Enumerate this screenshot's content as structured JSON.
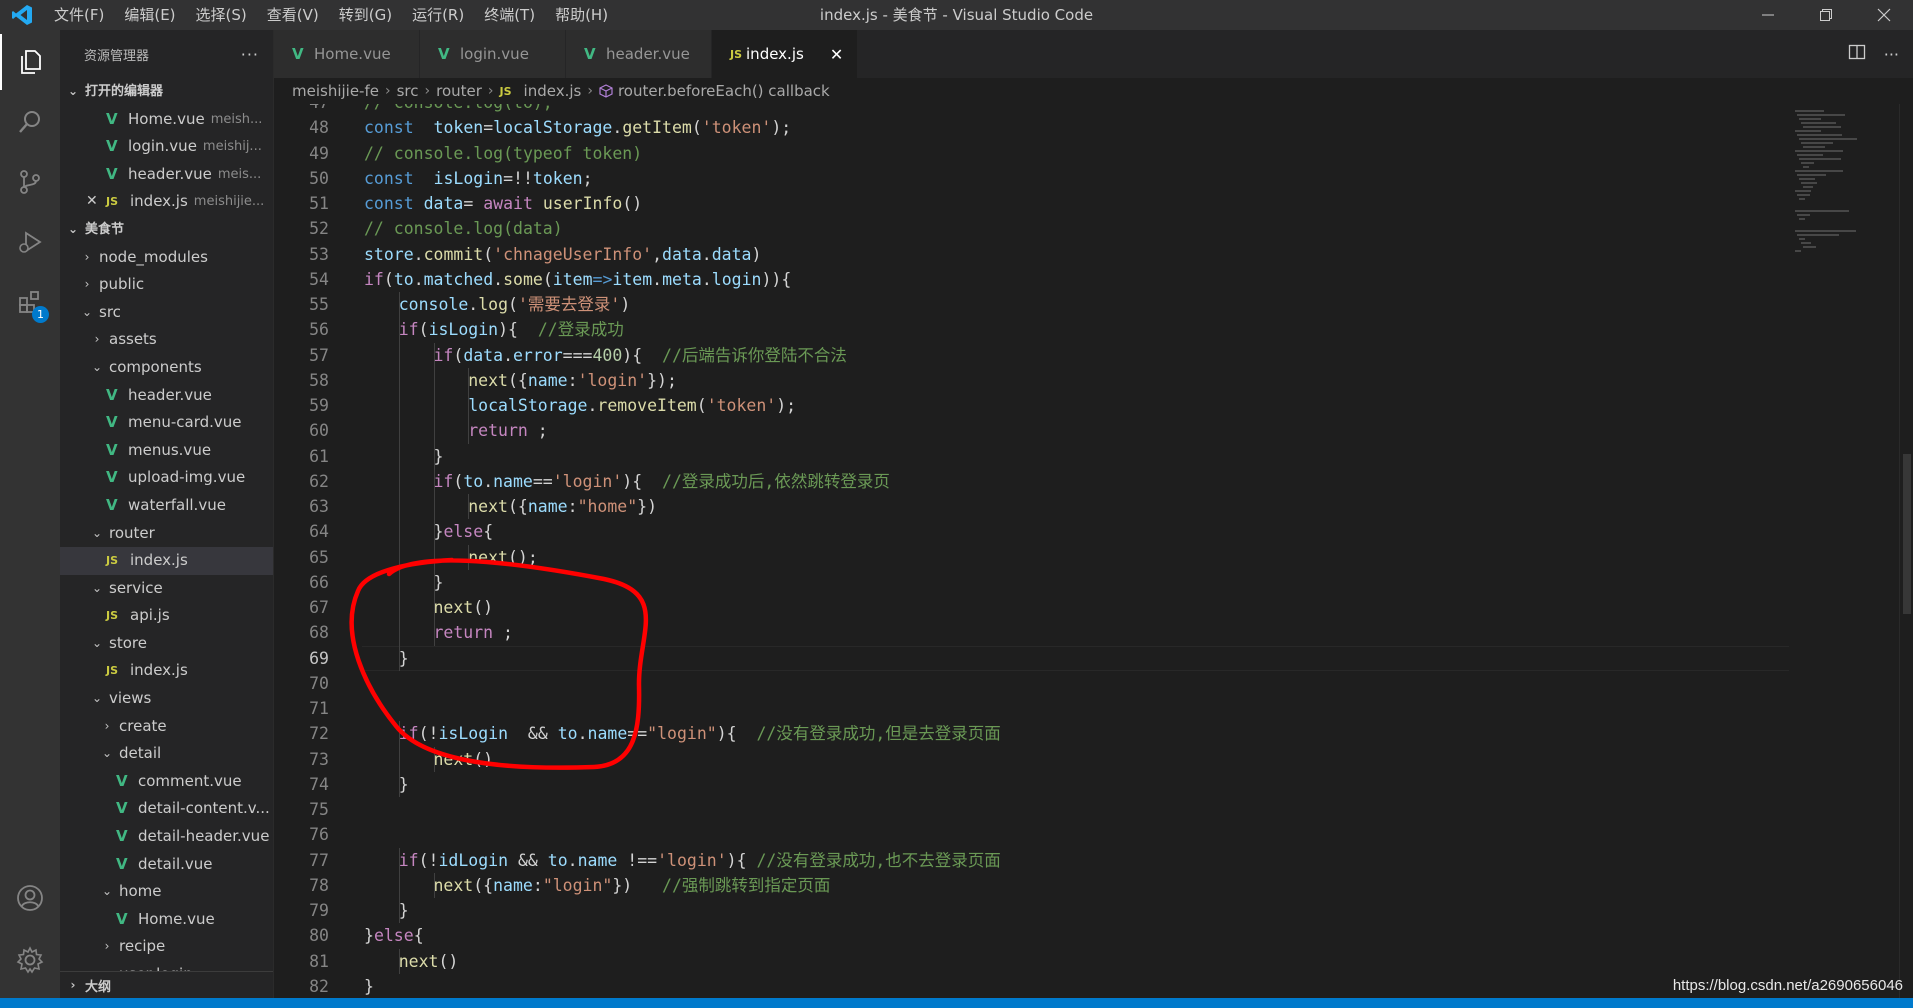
{
  "window": {
    "title": "index.js - 美食节 - Visual Studio Code",
    "menu": [
      "文件(F)",
      "编辑(E)",
      "选择(S)",
      "查看(V)",
      "转到(G)",
      "运行(R)",
      "终端(T)",
      "帮助(H)"
    ],
    "controls": [
      "minimize",
      "restore",
      "close"
    ]
  },
  "activity_bar": {
    "items": [
      "explorer-icon",
      "search-icon",
      "source-control-icon",
      "run-debug-icon",
      "extensions-icon"
    ],
    "extensions_badge": "1",
    "bottom": [
      "accounts-icon",
      "manage-gear-icon"
    ]
  },
  "sidebar": {
    "title": "资源管理器",
    "more": "···",
    "open_editors_label": "打开的编辑器",
    "open_editors": [
      {
        "name": "Home.vue",
        "desc": "meish...",
        "icon": "vue"
      },
      {
        "name": "login.vue",
        "desc": "meishij...",
        "icon": "vue"
      },
      {
        "name": "header.vue",
        "desc": "meis...",
        "icon": "vue"
      },
      {
        "name": "index.js",
        "desc": "meishijie...",
        "icon": "js",
        "close": "✕"
      }
    ],
    "workspace_label": "美食节",
    "tree": [
      {
        "name": "node_modules",
        "depth": 1,
        "type": "folder-closed"
      },
      {
        "name": "public",
        "depth": 1,
        "type": "folder-closed"
      },
      {
        "name": "src",
        "depth": 1,
        "type": "folder-open"
      },
      {
        "name": "assets",
        "depth": 2,
        "type": "folder-closed"
      },
      {
        "name": "components",
        "depth": 2,
        "type": "folder-open"
      },
      {
        "name": "header.vue",
        "depth": 3,
        "type": "vue"
      },
      {
        "name": "menu-card.vue",
        "depth": 3,
        "type": "vue"
      },
      {
        "name": "menus.vue",
        "depth": 3,
        "type": "vue"
      },
      {
        "name": "upload-img.vue",
        "depth": 3,
        "type": "vue"
      },
      {
        "name": "waterfall.vue",
        "depth": 3,
        "type": "vue"
      },
      {
        "name": "router",
        "depth": 2,
        "type": "folder-open"
      },
      {
        "name": "index.js",
        "depth": 3,
        "type": "js",
        "selected": true
      },
      {
        "name": "service",
        "depth": 2,
        "type": "folder-open"
      },
      {
        "name": "api.js",
        "depth": 3,
        "type": "js"
      },
      {
        "name": "store",
        "depth": 2,
        "type": "folder-open"
      },
      {
        "name": "index.js",
        "depth": 3,
        "type": "js"
      },
      {
        "name": "views",
        "depth": 2,
        "type": "folder-open"
      },
      {
        "name": "create",
        "depth": 3,
        "type": "folder-closed"
      },
      {
        "name": "detail",
        "depth": 3,
        "type": "folder-open"
      },
      {
        "name": "comment.vue",
        "depth": 4,
        "type": "vue"
      },
      {
        "name": "detail-content.v...",
        "depth": 4,
        "type": "vue"
      },
      {
        "name": "detail-header.vue",
        "depth": 4,
        "type": "vue"
      },
      {
        "name": "detail.vue",
        "depth": 4,
        "type": "vue"
      },
      {
        "name": "home",
        "depth": 3,
        "type": "folder-open"
      },
      {
        "name": "Home.vue",
        "depth": 4,
        "type": "vue"
      },
      {
        "name": "recipe",
        "depth": 3,
        "type": "folder-closed"
      },
      {
        "name": "user-login",
        "depth": 3,
        "type": "folder-open"
      }
    ],
    "outline_label": "大纲"
  },
  "tabs": [
    {
      "label": "Home.vue",
      "icon": "vue",
      "active": false
    },
    {
      "label": "login.vue",
      "icon": "vue",
      "active": false
    },
    {
      "label": "header.vue",
      "icon": "vue",
      "active": false
    },
    {
      "label": "index.js",
      "icon": "js",
      "active": true,
      "close": "✕"
    }
  ],
  "breadcrumb": [
    "meishijie-fe",
    "src",
    "router",
    "index.js",
    "router.beforeEach() callback"
  ],
  "editor": {
    "current_line": 69,
    "lines": [
      {
        "n": 47,
        "indent": 1,
        "tokens": [
          [
            "c",
            "// console.log(to);"
          ]
        ]
      },
      {
        "n": 48,
        "indent": 1,
        "tokens": [
          [
            "k",
            "const"
          ],
          [
            "p",
            "  "
          ],
          [
            "v",
            "token"
          ],
          [
            "p",
            "="
          ],
          [
            "v",
            "localStorage"
          ],
          [
            "p",
            "."
          ],
          [
            "f",
            "getItem"
          ],
          [
            "p",
            "("
          ],
          [
            "s",
            "'token'"
          ],
          [
            "p",
            ");"
          ]
        ]
      },
      {
        "n": 49,
        "indent": 1,
        "tokens": [
          [
            "c",
            "// console.log(typeof token)"
          ]
        ]
      },
      {
        "n": 50,
        "indent": 1,
        "tokens": [
          [
            "k",
            "const"
          ],
          [
            "p",
            "  "
          ],
          [
            "v",
            "isLogin"
          ],
          [
            "p",
            "=!!"
          ],
          [
            "v",
            "token"
          ],
          [
            "p",
            ";"
          ]
        ]
      },
      {
        "n": 51,
        "indent": 1,
        "tokens": [
          [
            "k",
            "const"
          ],
          [
            "p",
            " "
          ],
          [
            "v",
            "data"
          ],
          [
            "p",
            "= "
          ],
          [
            "kw",
            "await"
          ],
          [
            "p",
            " "
          ],
          [
            "f",
            "userInfo"
          ],
          [
            "p",
            "()"
          ]
        ]
      },
      {
        "n": 52,
        "indent": 1,
        "tokens": [
          [
            "c",
            "// console.log(data)"
          ]
        ]
      },
      {
        "n": 53,
        "indent": 1,
        "tokens": [
          [
            "v",
            "store"
          ],
          [
            "p",
            "."
          ],
          [
            "f",
            "commit"
          ],
          [
            "p",
            "("
          ],
          [
            "s",
            "'chnageUserInfo'"
          ],
          [
            "p",
            ","
          ],
          [
            "v",
            "data"
          ],
          [
            "p",
            "."
          ],
          [
            "v",
            "data"
          ],
          [
            "p",
            ")"
          ]
        ]
      },
      {
        "n": 54,
        "indent": 1,
        "tokens": [
          [
            "kw",
            "if"
          ],
          [
            "p",
            "("
          ],
          [
            "v",
            "to"
          ],
          [
            "p",
            "."
          ],
          [
            "v",
            "matched"
          ],
          [
            "p",
            "."
          ],
          [
            "f",
            "some"
          ],
          [
            "p",
            "("
          ],
          [
            "v",
            "item"
          ],
          [
            "k",
            "=>"
          ],
          [
            "v",
            "item"
          ],
          [
            "p",
            "."
          ],
          [
            "v",
            "meta"
          ],
          [
            "p",
            "."
          ],
          [
            "v",
            "login"
          ],
          [
            "p",
            ")){"
          ]
        ]
      },
      {
        "n": 55,
        "indent": 2,
        "tokens": [
          [
            "v",
            "console"
          ],
          [
            "p",
            "."
          ],
          [
            "f",
            "log"
          ],
          [
            "p",
            "("
          ],
          [
            "s",
            "'需要去登录'"
          ],
          [
            "p",
            ")"
          ]
        ]
      },
      {
        "n": 56,
        "indent": 2,
        "tokens": [
          [
            "kw",
            "if"
          ],
          [
            "p",
            "("
          ],
          [
            "v",
            "isLogin"
          ],
          [
            "p",
            "){  "
          ],
          [
            "c",
            "//登录成功"
          ]
        ]
      },
      {
        "n": 57,
        "indent": 3,
        "tokens": [
          [
            "kw",
            "if"
          ],
          [
            "p",
            "("
          ],
          [
            "v",
            "data"
          ],
          [
            "p",
            "."
          ],
          [
            "v",
            "error"
          ],
          [
            "p",
            "==="
          ],
          [
            "n",
            "400"
          ],
          [
            "p",
            "){  "
          ],
          [
            "c",
            "//后端告诉你登陆不合法"
          ]
        ]
      },
      {
        "n": 58,
        "indent": 4,
        "tokens": [
          [
            "f",
            "next"
          ],
          [
            "p",
            "({"
          ],
          [
            "v",
            "name"
          ],
          [
            "p",
            ":"
          ],
          [
            "s",
            "'login'"
          ],
          [
            "p",
            "});"
          ]
        ]
      },
      {
        "n": 59,
        "indent": 4,
        "tokens": [
          [
            "v",
            "localStorage"
          ],
          [
            "p",
            "."
          ],
          [
            "f",
            "removeItem"
          ],
          [
            "p",
            "("
          ],
          [
            "s",
            "'token'"
          ],
          [
            "p",
            ");"
          ]
        ]
      },
      {
        "n": 60,
        "indent": 4,
        "tokens": [
          [
            "kw",
            "return"
          ],
          [
            "p",
            " ;"
          ]
        ]
      },
      {
        "n": 61,
        "indent": 3,
        "tokens": [
          [
            "p",
            "}"
          ]
        ]
      },
      {
        "n": 62,
        "indent": 3,
        "tokens": [
          [
            "kw",
            "if"
          ],
          [
            "p",
            "("
          ],
          [
            "v",
            "to"
          ],
          [
            "p",
            "."
          ],
          [
            "v",
            "name"
          ],
          [
            "p",
            "=="
          ],
          [
            "s",
            "'login'"
          ],
          [
            "p",
            "){  "
          ],
          [
            "c",
            "//登录成功后,依然跳转登录页"
          ]
        ]
      },
      {
        "n": 63,
        "indent": 4,
        "tokens": [
          [
            "f",
            "next"
          ],
          [
            "p",
            "({"
          ],
          [
            "v",
            "name"
          ],
          [
            "p",
            ":"
          ],
          [
            "s",
            "\"home\""
          ],
          [
            "p",
            "})"
          ]
        ]
      },
      {
        "n": 64,
        "indent": 3,
        "tokens": [
          [
            "p",
            "}"
          ],
          [
            "kw",
            "else"
          ],
          [
            "p",
            "{"
          ]
        ]
      },
      {
        "n": 65,
        "indent": 4,
        "tokens": [
          [
            "f",
            "next"
          ],
          [
            "p",
            "();"
          ]
        ]
      },
      {
        "n": 66,
        "indent": 3,
        "tokens": [
          [
            "p",
            "}"
          ]
        ]
      },
      {
        "n": 67,
        "indent": 3,
        "tokens": [
          [
            "f",
            "next"
          ],
          [
            "p",
            "()"
          ]
        ]
      },
      {
        "n": 68,
        "indent": 3,
        "tokens": [
          [
            "kw",
            "return"
          ],
          [
            "p",
            " ;"
          ]
        ]
      },
      {
        "n": 69,
        "indent": 2,
        "tokens": [
          [
            "p",
            "}"
          ]
        ]
      },
      {
        "n": 70,
        "indent": 0,
        "tokens": []
      },
      {
        "n": 71,
        "indent": 0,
        "tokens": []
      },
      {
        "n": 72,
        "indent": 2,
        "tokens": [
          [
            "kw",
            "if"
          ],
          [
            "p",
            "(!"
          ],
          [
            "v",
            "isLogin"
          ],
          [
            "p",
            "  && "
          ],
          [
            "v",
            "to"
          ],
          [
            "p",
            "."
          ],
          [
            "v",
            "name"
          ],
          [
            "p",
            "=="
          ],
          [
            "s",
            "\"login\""
          ],
          [
            "p",
            "){  "
          ],
          [
            "c",
            "//没有登录成功,但是去登录页面"
          ]
        ]
      },
      {
        "n": 73,
        "indent": 3,
        "tokens": [
          [
            "f",
            "next"
          ],
          [
            "p",
            "()"
          ]
        ]
      },
      {
        "n": 74,
        "indent": 2,
        "tokens": [
          [
            "p",
            "}"
          ]
        ]
      },
      {
        "n": 75,
        "indent": 0,
        "tokens": []
      },
      {
        "n": 76,
        "indent": 0,
        "tokens": []
      },
      {
        "n": 77,
        "indent": 2,
        "tokens": [
          [
            "kw",
            "if"
          ],
          [
            "p",
            "(!"
          ],
          [
            "v",
            "idLogin"
          ],
          [
            "p",
            " && "
          ],
          [
            "v",
            "to"
          ],
          [
            "p",
            "."
          ],
          [
            "v",
            "name"
          ],
          [
            "p",
            " !=="
          ],
          [
            "s",
            "'login'"
          ],
          [
            "p",
            "){ "
          ],
          [
            "c",
            "//没有登录成功,也不去登录页面"
          ]
        ]
      },
      {
        "n": 78,
        "indent": 3,
        "tokens": [
          [
            "f",
            "next"
          ],
          [
            "p",
            "({"
          ],
          [
            "v",
            "name"
          ],
          [
            "p",
            ":"
          ],
          [
            "s",
            "\"login\""
          ],
          [
            "p",
            "})   "
          ],
          [
            "c",
            "//强制跳转到指定页面"
          ]
        ]
      },
      {
        "n": 79,
        "indent": 2,
        "tokens": [
          [
            "p",
            "}"
          ]
        ]
      },
      {
        "n": 80,
        "indent": 1,
        "tokens": [
          [
            "p",
            "}"
          ],
          [
            "kw",
            "else"
          ],
          [
            "p",
            "{"
          ]
        ]
      },
      {
        "n": 81,
        "indent": 2,
        "tokens": [
          [
            "f",
            "next"
          ],
          [
            "p",
            "()"
          ]
        ]
      },
      {
        "n": 82,
        "indent": 1,
        "tokens": [
          [
            "p",
            "}"
          ]
        ]
      }
    ]
  },
  "colors": {
    "keyword_blue": "#569cd6",
    "keyword_purple": "#c586c0",
    "variable": "#9cdcfe",
    "function": "#dcdcaa",
    "string": "#ce9178",
    "comment": "#6a9955",
    "number": "#b5cea8",
    "annotation_red": "#ff0000",
    "status_bar": "#007acc"
  },
  "watermark": "https://blog.csdn.net/a2690656046"
}
